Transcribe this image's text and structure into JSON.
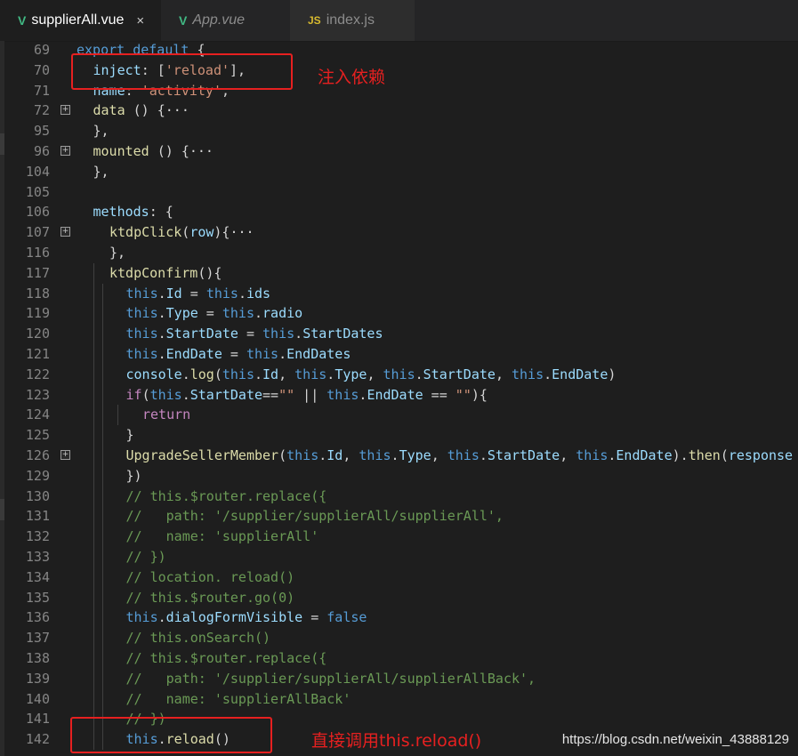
{
  "tabs": [
    {
      "label": "supplierAll.vue",
      "icon": "vue-icon",
      "active": true,
      "close": "×"
    },
    {
      "label": "App.vue",
      "icon": "vue-icon",
      "active": false
    },
    {
      "label": "index.js",
      "icon": "js-icon",
      "icon_text": "JS",
      "active": false
    }
  ],
  "lines": [
    {
      "n": "69",
      "fold": false,
      "indent": 0,
      "tokens": [
        [
          "k",
          "export"
        ],
        [
          "t",
          " "
        ],
        [
          "k",
          "default"
        ],
        [
          "t",
          " {"
        ]
      ]
    },
    {
      "n": "70",
      "fold": false,
      "indent": 1,
      "tokens": [
        [
          "prop",
          "inject"
        ],
        [
          "t",
          ": ["
        ],
        [
          "str",
          "'reload'"
        ],
        [
          "t",
          "],"
        ]
      ]
    },
    {
      "n": "71",
      "fold": false,
      "indent": 1,
      "tokens": [
        [
          "prop",
          "name"
        ],
        [
          "t",
          ": "
        ],
        [
          "str",
          "'activity'"
        ],
        [
          "t",
          ","
        ]
      ]
    },
    {
      "n": "72",
      "fold": true,
      "indent": 1,
      "tokens": [
        [
          "fn",
          "data"
        ],
        [
          "t",
          " () {"
        ],
        [
          "d",
          "···"
        ]
      ]
    },
    {
      "n": "95",
      "fold": false,
      "indent": 1,
      "tokens": [
        [
          "t",
          "},"
        ]
      ]
    },
    {
      "n": "96",
      "fold": true,
      "indent": 1,
      "tokens": [
        [
          "fn",
          "mounted"
        ],
        [
          "t",
          " () {"
        ],
        [
          "d",
          "···"
        ]
      ]
    },
    {
      "n": "104",
      "fold": false,
      "indent": 1,
      "tokens": [
        [
          "t",
          "},"
        ]
      ]
    },
    {
      "n": "105",
      "fold": false,
      "indent": 0,
      "tokens": []
    },
    {
      "n": "106",
      "fold": false,
      "indent": 1,
      "tokens": [
        [
          "prop",
          "methods"
        ],
        [
          "t",
          ": {"
        ]
      ]
    },
    {
      "n": "107",
      "fold": true,
      "indent": 2,
      "tokens": [
        [
          "fn",
          "ktdpClick"
        ],
        [
          "t",
          "("
        ],
        [
          "prop",
          "row"
        ],
        [
          "t",
          "){"
        ],
        [
          "d",
          "···"
        ]
      ]
    },
    {
      "n": "116",
      "fold": false,
      "indent": 2,
      "tokens": [
        [
          "t",
          "},"
        ]
      ]
    },
    {
      "n": "117",
      "fold": false,
      "indent": 2,
      "tokens": [
        [
          "fn",
          "ktdpConfirm"
        ],
        [
          "t",
          "(){"
        ]
      ]
    },
    {
      "n": "118",
      "fold": false,
      "indent": 3,
      "tokens": [
        [
          "k",
          "this"
        ],
        [
          "t",
          "."
        ],
        [
          "prop",
          "Id"
        ],
        [
          "t",
          " = "
        ],
        [
          "k",
          "this"
        ],
        [
          "t",
          "."
        ],
        [
          "prop",
          "ids"
        ]
      ]
    },
    {
      "n": "119",
      "fold": false,
      "indent": 3,
      "tokens": [
        [
          "k",
          "this"
        ],
        [
          "t",
          "."
        ],
        [
          "prop",
          "Type"
        ],
        [
          "t",
          " = "
        ],
        [
          "k",
          "this"
        ],
        [
          "t",
          "."
        ],
        [
          "prop",
          "radio"
        ]
      ]
    },
    {
      "n": "120",
      "fold": false,
      "indent": 3,
      "tokens": [
        [
          "k",
          "this"
        ],
        [
          "t",
          "."
        ],
        [
          "prop",
          "StartDate"
        ],
        [
          "t",
          " = "
        ],
        [
          "k",
          "this"
        ],
        [
          "t",
          "."
        ],
        [
          "prop",
          "StartDates"
        ]
      ]
    },
    {
      "n": "121",
      "fold": false,
      "indent": 3,
      "tokens": [
        [
          "k",
          "this"
        ],
        [
          "t",
          "."
        ],
        [
          "prop",
          "EndDate"
        ],
        [
          "t",
          " = "
        ],
        [
          "k",
          "this"
        ],
        [
          "t",
          "."
        ],
        [
          "prop",
          "EndDates"
        ]
      ]
    },
    {
      "n": "122",
      "fold": false,
      "indent": 3,
      "tokens": [
        [
          "prop",
          "console"
        ],
        [
          "t",
          "."
        ],
        [
          "fn",
          "log"
        ],
        [
          "t",
          "("
        ],
        [
          "k",
          "this"
        ],
        [
          "t",
          "."
        ],
        [
          "prop",
          "Id"
        ],
        [
          "t",
          ", "
        ],
        [
          "k",
          "this"
        ],
        [
          "t",
          "."
        ],
        [
          "prop",
          "Type"
        ],
        [
          "t",
          ", "
        ],
        [
          "k",
          "this"
        ],
        [
          "t",
          "."
        ],
        [
          "prop",
          "StartDate"
        ],
        [
          "t",
          ", "
        ],
        [
          "k",
          "this"
        ],
        [
          "t",
          "."
        ],
        [
          "prop",
          "EndDate"
        ],
        [
          "t",
          ")"
        ]
      ]
    },
    {
      "n": "123",
      "fold": false,
      "indent": 3,
      "tokens": [
        [
          "kw2",
          "if"
        ],
        [
          "t",
          "("
        ],
        [
          "k",
          "this"
        ],
        [
          "t",
          "."
        ],
        [
          "prop",
          "StartDate"
        ],
        [
          "t",
          "=="
        ],
        [
          "str",
          "\"\""
        ],
        [
          "t",
          " || "
        ],
        [
          "k",
          "this"
        ],
        [
          "t",
          "."
        ],
        [
          "prop",
          "EndDate"
        ],
        [
          "t",
          " == "
        ],
        [
          "str",
          "\"\""
        ],
        [
          "t",
          "){"
        ]
      ]
    },
    {
      "n": "124",
      "fold": false,
      "indent": 4,
      "tokens": [
        [
          "kw2",
          "return"
        ]
      ]
    },
    {
      "n": "125",
      "fold": false,
      "indent": 3,
      "tokens": [
        [
          "t",
          "}"
        ]
      ]
    },
    {
      "n": "126",
      "fold": true,
      "indent": 3,
      "tokens": [
        [
          "fn",
          "UpgradeSellerMember"
        ],
        [
          "t",
          "("
        ],
        [
          "k",
          "this"
        ],
        [
          "t",
          "."
        ],
        [
          "prop",
          "Id"
        ],
        [
          "t",
          ", "
        ],
        [
          "k",
          "this"
        ],
        [
          "t",
          "."
        ],
        [
          "prop",
          "Type"
        ],
        [
          "t",
          ", "
        ],
        [
          "k",
          "this"
        ],
        [
          "t",
          "."
        ],
        [
          "prop",
          "StartDate"
        ],
        [
          "t",
          ", "
        ],
        [
          "k",
          "this"
        ],
        [
          "t",
          "."
        ],
        [
          "prop",
          "EndDate"
        ],
        [
          "t",
          ")."
        ],
        [
          "fn",
          "then"
        ],
        [
          "t",
          "("
        ],
        [
          "prop",
          "response"
        ]
      ]
    },
    {
      "n": "129",
      "fold": false,
      "indent": 3,
      "tokens": [
        [
          "t",
          "})"
        ]
      ]
    },
    {
      "n": "130",
      "fold": false,
      "indent": 3,
      "tokens": [
        [
          "cm",
          "// this.$router.replace({"
        ]
      ]
    },
    {
      "n": "131",
      "fold": false,
      "indent": 3,
      "tokens": [
        [
          "cm",
          "//   path: '/supplier/supplierAll/supplierAll',"
        ]
      ]
    },
    {
      "n": "132",
      "fold": false,
      "indent": 3,
      "tokens": [
        [
          "cm",
          "//   name: 'supplierAll'"
        ]
      ]
    },
    {
      "n": "133",
      "fold": false,
      "indent": 3,
      "tokens": [
        [
          "cm",
          "// })"
        ]
      ]
    },
    {
      "n": "134",
      "fold": false,
      "indent": 3,
      "tokens": [
        [
          "cm",
          "// location. reload()"
        ]
      ]
    },
    {
      "n": "135",
      "fold": false,
      "indent": 3,
      "tokens": [
        [
          "cm",
          "// this.$router.go(0)"
        ]
      ]
    },
    {
      "n": "136",
      "fold": false,
      "indent": 3,
      "tokens": [
        [
          "k",
          "this"
        ],
        [
          "t",
          "."
        ],
        [
          "prop",
          "dialogFormVisible"
        ],
        [
          "t",
          " = "
        ],
        [
          "k",
          "false"
        ]
      ]
    },
    {
      "n": "137",
      "fold": false,
      "indent": 3,
      "tokens": [
        [
          "cm",
          "// this.onSearch()"
        ]
      ]
    },
    {
      "n": "138",
      "fold": false,
      "indent": 3,
      "tokens": [
        [
          "cm",
          "// this.$router.replace({"
        ]
      ]
    },
    {
      "n": "139",
      "fold": false,
      "indent": 3,
      "tokens": [
        [
          "cm",
          "//   path: '/supplier/supplierAll/supplierAllBack',"
        ]
      ]
    },
    {
      "n": "140",
      "fold": false,
      "indent": 3,
      "tokens": [
        [
          "cm",
          "//   name: 'supplierAllBack'"
        ]
      ]
    },
    {
      "n": "141",
      "fold": false,
      "indent": 3,
      "tokens": [
        [
          "cm",
          "// })"
        ]
      ]
    },
    {
      "n": "142",
      "fold": false,
      "indent": 3,
      "tokens": [
        [
          "k",
          "this"
        ],
        [
          "t",
          "."
        ],
        [
          "fn",
          "reload"
        ],
        [
          "t",
          "()"
        ]
      ]
    }
  ],
  "annotations": {
    "inject_note": "注入依赖",
    "reload_note": "直接调用this.reload()",
    "color": "#e62020"
  },
  "watermark": "https://blog.csdn.net/weixin_43888129"
}
